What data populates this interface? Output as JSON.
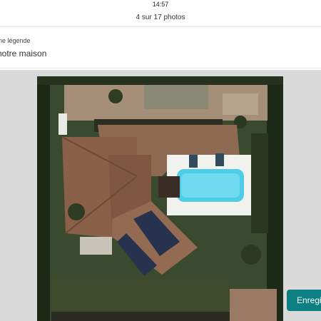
{
  "status_bar": {
    "time": "14:57"
  },
  "header": {
    "title": "4 sur 17 photos"
  },
  "caption": {
    "label": "ne légende",
    "value": "notre maison"
  },
  "photo": {
    "subject": "aerial view of house with pool"
  },
  "actions": {
    "save_label": "Enregi"
  },
  "colors": {
    "accent": "#0d7f82",
    "photo_backdrop": "#dadada"
  }
}
